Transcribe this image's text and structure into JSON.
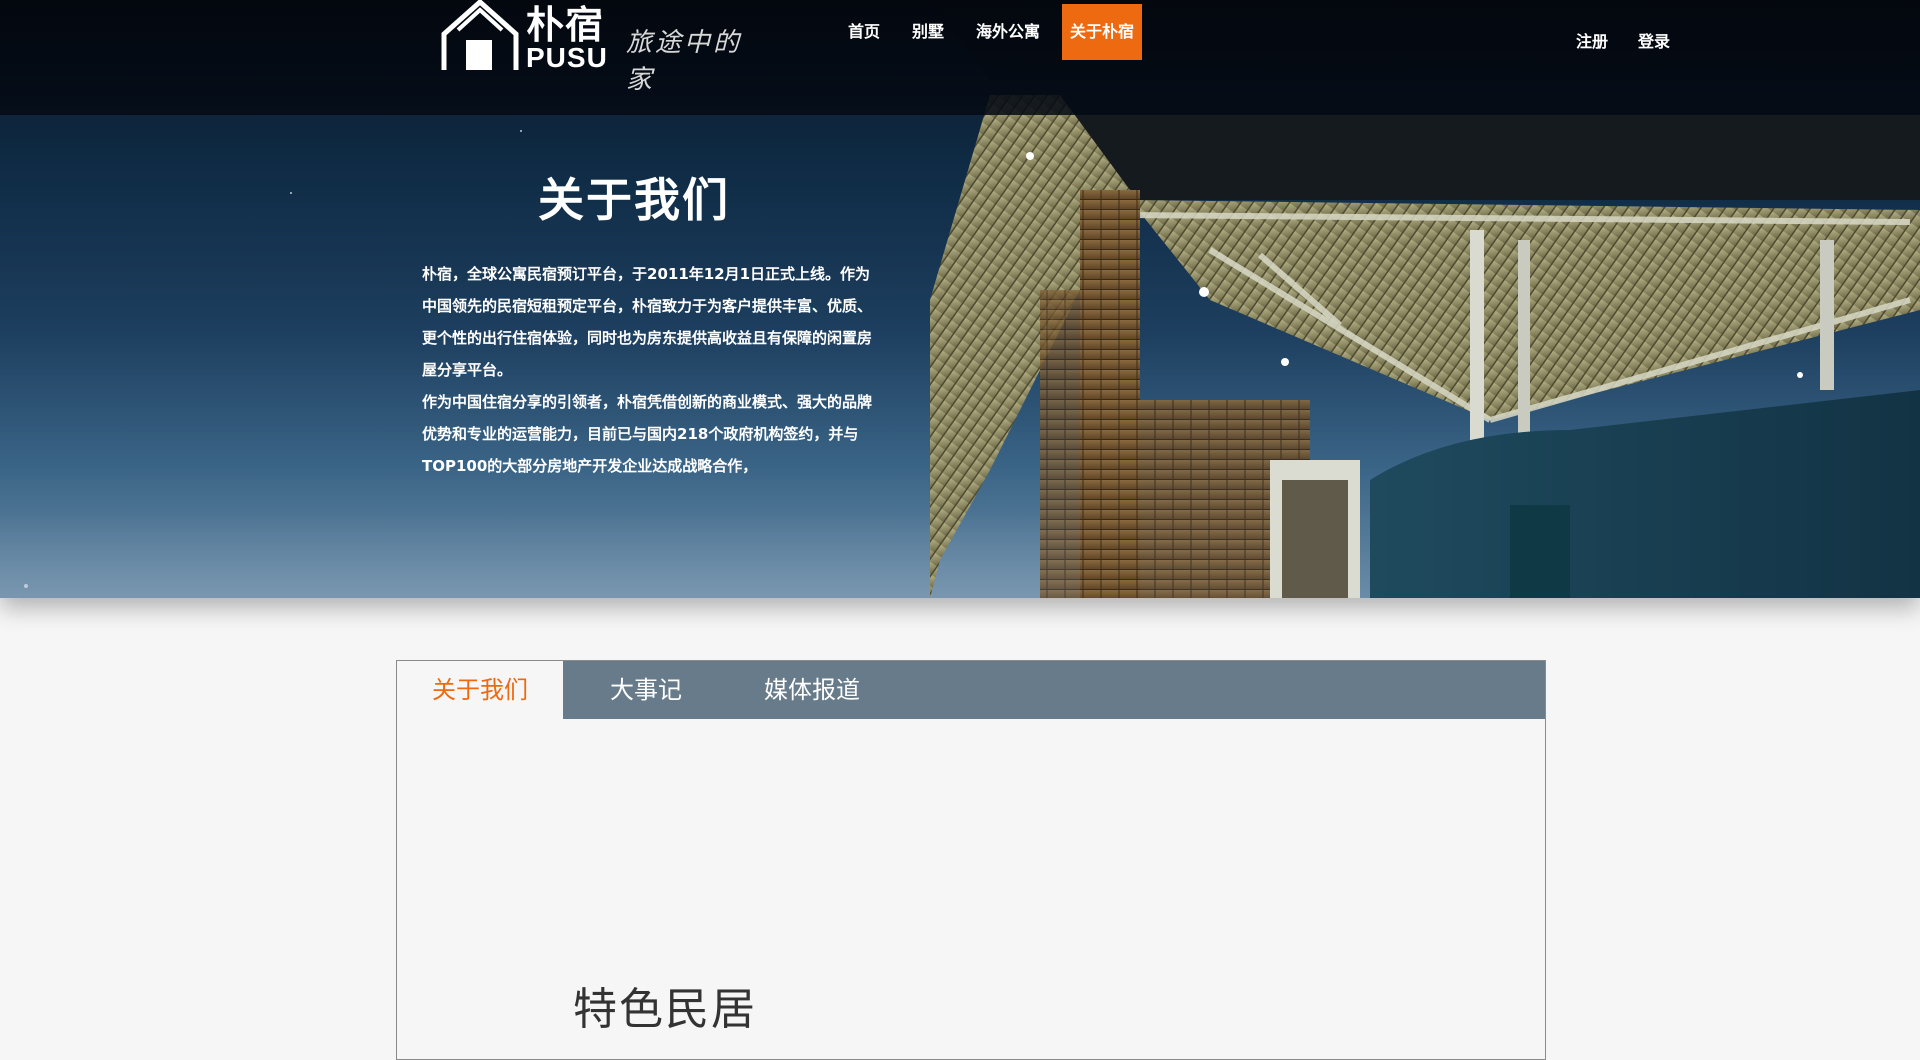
{
  "brand": {
    "name_cn": "朴宿",
    "name_en": "PUSU",
    "slogan": "旅途中的家"
  },
  "nav": {
    "items": [
      {
        "label": "首页"
      },
      {
        "label": "别墅"
      },
      {
        "label": "海外公寓"
      },
      {
        "label": "关于朴宿"
      }
    ],
    "active": "关于朴宿"
  },
  "auth": {
    "register": "注册",
    "login": "登录"
  },
  "hero": {
    "title": "关于我们",
    "paragraphs": [
      "朴宿，全球公寓民宿预订平台，于2011年12月1日正式上线。作为中国领先的民宿短租预定平台，朴宿致力于为客户提供丰富、优质、更个性的出行住宿体验，同时也为房东提供高收益且有保障的闲置房屋分享平台。",
      "作为中国住宿分享的引领者，朴宿凭借创新的商业模式、强大的品牌优势和专业的运营能力，目前已与国内218个政府机构签约，并与TOP100的大部分房地产开发企业达成战略合作，"
    ]
  },
  "tabs": {
    "items": [
      {
        "label": "关于我们"
      },
      {
        "label": "大事记"
      },
      {
        "label": "媒体报道"
      }
    ],
    "active": "关于我们"
  },
  "content": {
    "section_title": "特色民居"
  },
  "colors": {
    "accent": "#ee6a10",
    "tab_bar": "#677b8a",
    "page_bg": "#f6f6f6"
  }
}
